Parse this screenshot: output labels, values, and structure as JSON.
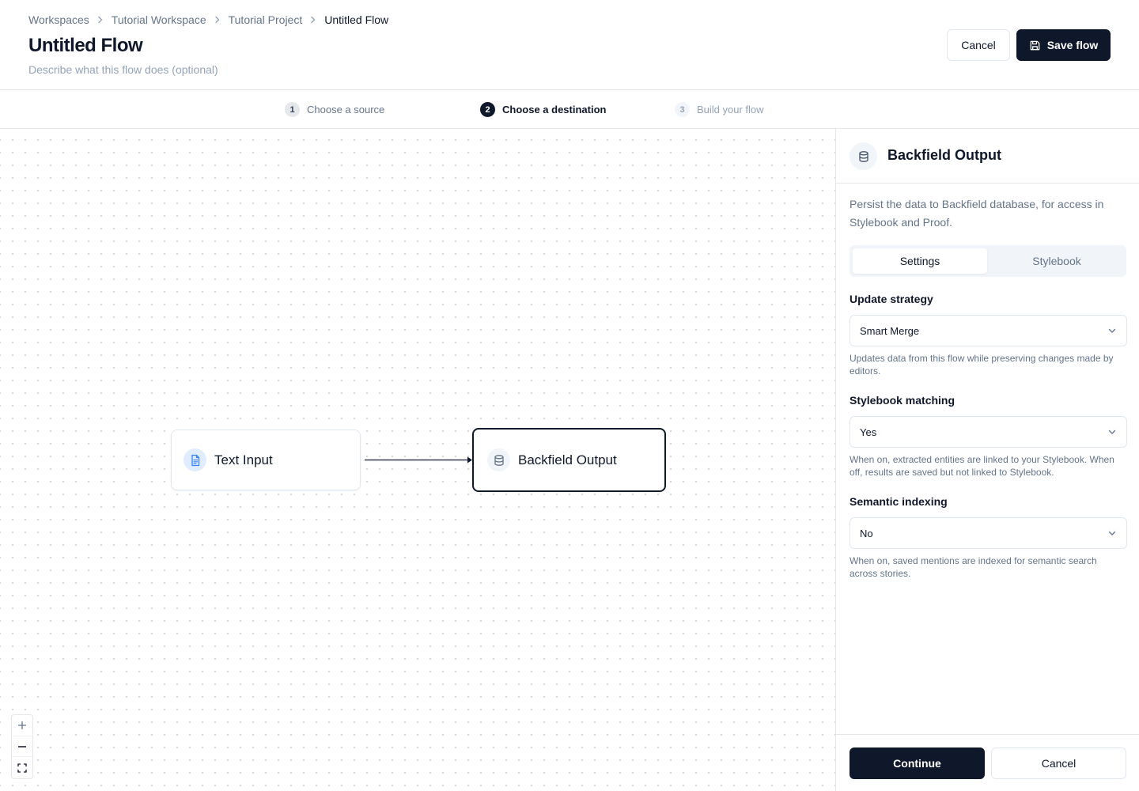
{
  "breadcrumb": {
    "items": [
      "Workspaces",
      "Tutorial Workspace",
      "Tutorial Project",
      "Untitled Flow"
    ]
  },
  "header": {
    "title": "Untitled Flow",
    "description_placeholder": "Describe what this flow does (optional)",
    "cancel_label": "Cancel",
    "save_label": "Save flow"
  },
  "steps": [
    {
      "number": "1",
      "label": "Choose a source",
      "state": "done"
    },
    {
      "number": "2",
      "label": "Choose a destination",
      "state": "active"
    },
    {
      "number": "3",
      "label": "Build your flow",
      "state": "todo"
    }
  ],
  "canvas": {
    "nodes": [
      {
        "label": "Text Input",
        "icon": "document-icon"
      },
      {
        "label": "Backfield Output",
        "icon": "database-icon",
        "selected": true
      }
    ],
    "zoom_controls": [
      "zoom-in-icon",
      "zoom-out-icon",
      "fit-view-icon"
    ]
  },
  "panel": {
    "title": "Backfield Output",
    "icon": "database-icon",
    "description": "Persist the data to Backfield database, for access in Stylebook and Proof.",
    "tabs": [
      {
        "label": "Settings",
        "active": true
      },
      {
        "label": "Stylebook",
        "active": false
      }
    ],
    "fields": [
      {
        "label": "Update strategy",
        "value": "Smart Merge",
        "help": "Updates data from this flow while preserving changes made by editors."
      },
      {
        "label": "Stylebook matching",
        "value": "Yes",
        "help": "When on, extracted entities are linked to your Stylebook. When off, results are saved but not linked to Stylebook."
      },
      {
        "label": "Semantic indexing",
        "value": "No",
        "help": "When on, saved mentions are indexed for semantic search across stories."
      }
    ],
    "continue_label": "Continue",
    "cancel_label": "Cancel"
  },
  "colors": {
    "primary": "#0f172a",
    "muted": "#64748b",
    "border": "#e2e8f0",
    "text_input_icon_bg": "#e0ecff",
    "text_input_icon": "#3b82f6"
  }
}
